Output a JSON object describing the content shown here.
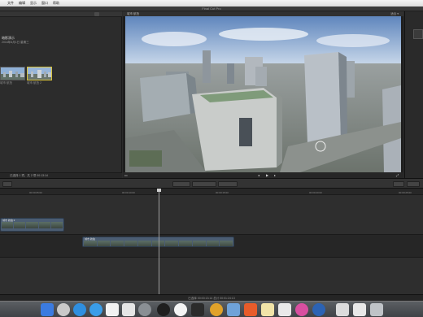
{
  "menubar": {
    "items": [
      "文件",
      "编辑",
      "显示",
      "窗口",
      "帮助"
    ]
  },
  "window": {
    "title": "Final Cut Pro"
  },
  "browser": {
    "event_title": "暗影演示",
    "event_date": "2016年6月1日 星期三",
    "thumbs": [
      {
        "label": "城市 航拍"
      },
      {
        "label": "城市 航拍 2"
      }
    ],
    "status": "已选择 1 项，共 2 项  00:13:14"
  },
  "viewer": {
    "header": "城市 航拍",
    "zoom": "适合 ▾"
  },
  "timeline": {
    "ticks": [
      "00:00:05:00",
      "00:00:10:00",
      "00:00:15:00",
      "00:00:20:00",
      "00:00:25:00"
    ],
    "upper_clip_label": "城市 航拍 2",
    "lower_clip_label": "城市 航拍",
    "footer": "已选择 00:00:13:14 总计 00:01:24:13"
  },
  "colors": {
    "selection_yellow": "#d8c23b",
    "clip_blue": "#4b5d73",
    "sky": "#6f93c2"
  },
  "icons": [
    "finder-icon",
    "launchpad-icon",
    "safari-icon",
    "app-store-icon",
    "calendar-icon",
    "preview-icon",
    "system-preferences-icon",
    "qq-icon",
    "google-chrome-icon",
    "clapper-icon",
    "chrome-icon",
    "mail-icon",
    "xmind-icon",
    "notes-icon",
    "itunes-icon",
    "quicktime-icon",
    "documents-icon",
    "trash-icon"
  ]
}
